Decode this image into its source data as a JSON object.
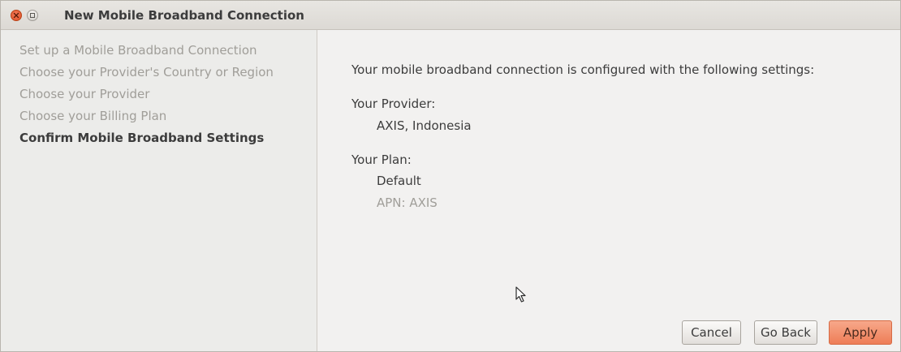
{
  "window": {
    "title": "New Mobile Broadband Connection"
  },
  "sidebar": {
    "steps": [
      {
        "label": "Set up a Mobile Broadband Connection",
        "active": false
      },
      {
        "label": "Choose your Provider's Country or Region",
        "active": false
      },
      {
        "label": "Choose your Provider",
        "active": false
      },
      {
        "label": "Choose your Billing Plan",
        "active": false
      },
      {
        "label": "Confirm Mobile Broadband Settings",
        "active": true
      }
    ]
  },
  "main": {
    "intro": "Your mobile broadband connection is configured with the following settings:",
    "provider_heading": "Your Provider:",
    "provider_value": "AXIS, Indonesia",
    "plan_heading": "Your Plan:",
    "plan_value": "Default",
    "apn": "APN: AXIS"
  },
  "buttons": {
    "cancel": "Cancel",
    "go_back": "Go Back",
    "apply": "Apply"
  },
  "colors": {
    "accent": "#ee7d57",
    "close_button": "#dc4d23"
  },
  "icons": {
    "close": "close-icon",
    "maximize": "maximize-icon",
    "cursor": "mouse-pointer-icon"
  }
}
